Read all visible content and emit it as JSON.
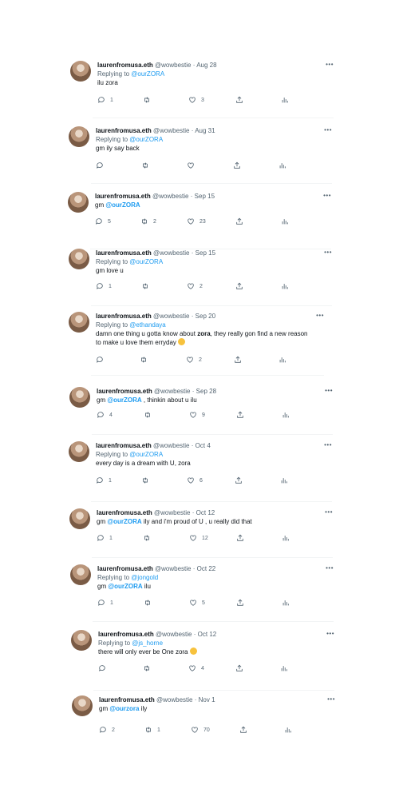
{
  "tweets": [
    {
      "name": "laurenfromusa.eth",
      "handle": "@wowbestie",
      "sep": "·",
      "date": "Aug 28",
      "replying_label": "Replying to ",
      "replying_to": "@ourZORA",
      "text_parts": [
        "ilu zora"
      ],
      "replies": "1",
      "retweets": "",
      "likes": "3"
    },
    {
      "name": "laurenfromusa.eth",
      "handle": "@wowbestie",
      "sep": "·",
      "date": "Aug 31",
      "replying_label": "Replying to ",
      "replying_to": "@ourZORA",
      "text_parts": [
        "gm ily say back"
      ],
      "replies": "",
      "retweets": "",
      "likes": ""
    },
    {
      "name": "laurenfromusa.eth",
      "handle": "@wowbestie",
      "sep": "·",
      "date": "Sep 15",
      "text_parts": [
        "gm ",
        "@ourZORA"
      ],
      "replies": "5",
      "retweets": "2",
      "likes": "23"
    },
    {
      "name": "laurenfromusa.eth",
      "handle": "@wowbestie",
      "sep": "·",
      "date": "Sep 15",
      "replying_label": "Replying to ",
      "replying_to": "@ourZORA",
      "text_parts": [
        "gm love u"
      ],
      "replies": "1",
      "retweets": "",
      "likes": "2"
    },
    {
      "name": "laurenfromusa.eth",
      "handle": "@wowbestie",
      "sep": "·",
      "date": "Sep 20",
      "replying_label": "Replying to ",
      "replying_to": "@ethandaya",
      "text_parts": [
        "damn one thing u gotta know about ",
        "zora",
        ", they really gon find a new reason",
        "to make u love them erryday "
      ],
      "replies": "",
      "retweets": "",
      "likes": "2"
    },
    {
      "name": "laurenfromusa.eth",
      "handle": "@wowbestie",
      "sep": "·",
      "date": "Sep 28",
      "text_parts": [
        "gm ",
        "@ourZORA",
        " , thinkin about u ilu"
      ],
      "replies": "4",
      "retweets": "",
      "likes": "9"
    },
    {
      "name": "laurenfromusa.eth",
      "handle": "@wowbestie",
      "sep": "·",
      "date": "Oct 4",
      "replying_label": "Replying to ",
      "replying_to": "@ourZORA",
      "text_parts": [
        "every day is a dream with U, zora"
      ],
      "replies": "1",
      "retweets": "",
      "likes": "6"
    },
    {
      "name": "laurenfromusa.eth",
      "handle": "@wowbestie",
      "sep": "·",
      "date": "Oct 12",
      "text_parts": [
        "gm ",
        "@ourZORA",
        " ily and i'm proud of U , u really did that"
      ],
      "replies": "1",
      "retweets": "",
      "likes": "12"
    },
    {
      "name": "laurenfromusa.eth",
      "handle": "@wowbestie",
      "sep": "·",
      "date": "Oct 22",
      "replying_label": "Replying to ",
      "replying_to": "@jongold",
      "text_parts": [
        "gm ",
        "@ourZORA",
        " ilu"
      ],
      "replies": "1",
      "retweets": "",
      "likes": "5"
    },
    {
      "name": "laurenfromusa.eth",
      "handle": "@wowbestie",
      "sep": "·",
      "date": "Oct 12",
      "replying_label": "Replying to ",
      "replying_to": "@js_horne",
      "text_parts": [
        "there will only ever be One zora "
      ],
      "replies": "",
      "retweets": "",
      "likes": "4"
    },
    {
      "name": "laurenfromusa.eth",
      "handle": "@wowbestie",
      "sep": "·",
      "date": "Nov 1",
      "text_parts": [
        "gm ",
        "@ourzora",
        " ily"
      ],
      "replies": "2",
      "retweets": "1",
      "likes": "70"
    }
  ],
  "more_glyph": "•••"
}
